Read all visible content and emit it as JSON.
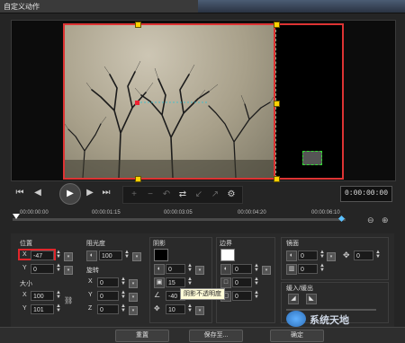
{
  "window": {
    "title": "自定义动作"
  },
  "timeline": {
    "timecode": "0:00:00:00",
    "ticks": [
      "00:00:00:00",
      "00:00:01:15",
      "00:00:03:05",
      "00:00:04:20",
      "00:00:06:10"
    ]
  },
  "panel": {
    "position": {
      "label": "位置",
      "x": "-47",
      "y": "0"
    },
    "size": {
      "label": "大小",
      "x": "100",
      "y": "101"
    },
    "opacity": {
      "label": "阻光度",
      "value": "100"
    },
    "rotation": {
      "label": "旋转",
      "x": "0",
      "y": "0",
      "z": "0"
    },
    "shadow": {
      "label": "阴影",
      "v1": "0",
      "v2": "15",
      "v3": "-40",
      "v4": "10",
      "tooltip": "阴影不透明度"
    },
    "border": {
      "label": "边界",
      "v1": "0",
      "v2": "0",
      "v3": "0"
    },
    "mirror": {
      "label": "镜面",
      "v1": "0",
      "v2": "0",
      "v3": "0"
    },
    "fade": {
      "label": "缓入/缓出"
    },
    "axes": {
      "x": "X",
      "y": "Y",
      "z": "Z"
    }
  },
  "buttons": {
    "reset": "重置",
    "save_as": "保存至...",
    "ok": "确定"
  },
  "watermark": "系统天地"
}
